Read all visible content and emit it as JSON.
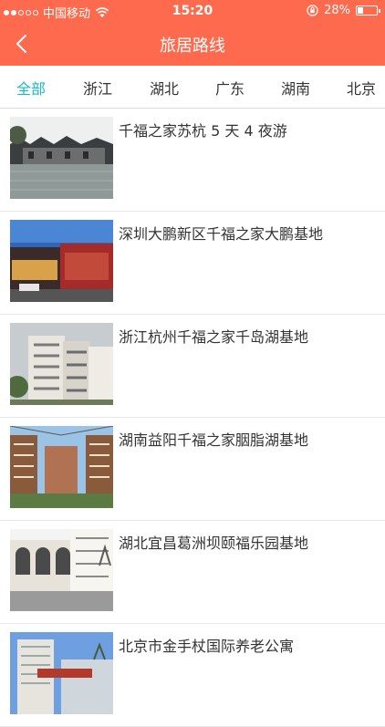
{
  "status_bar": {
    "carrier": "中国移动",
    "time": "15:20",
    "battery": "28%",
    "battery_level": 0.28,
    "signal_bars_filled": 2,
    "signal_bars_total": 5,
    "wifi_icon": "wifi-icon",
    "lock_icon": "orientation-lock-icon"
  },
  "nav": {
    "title": "旅居路线",
    "back_icon": "chevron-left-icon"
  },
  "tabs": [
    {
      "label": "全部",
      "active": true
    },
    {
      "label": "浙江",
      "active": false
    },
    {
      "label": "湖北",
      "active": false
    },
    {
      "label": "广东",
      "active": false
    },
    {
      "label": "湖南",
      "active": false
    },
    {
      "label": "北京",
      "active": false
    }
  ],
  "routes": [
    {
      "title": "千福之家苏杭 5 天 4 夜游"
    },
    {
      "title": "深圳大鹏新区千福之家大鹏基地"
    },
    {
      "title": "浙江杭州千福之家千岛湖基地"
    },
    {
      "title": "湖南益阳千福之家胭脂湖基地"
    },
    {
      "title": "湖北宜昌葛洲坝颐福乐园基地"
    },
    {
      "title": "北京市金手杖国际养老公寓"
    }
  ],
  "colors": {
    "header": "#fd6a4d",
    "active_tab": "#19b9c4",
    "text": "#333333"
  }
}
